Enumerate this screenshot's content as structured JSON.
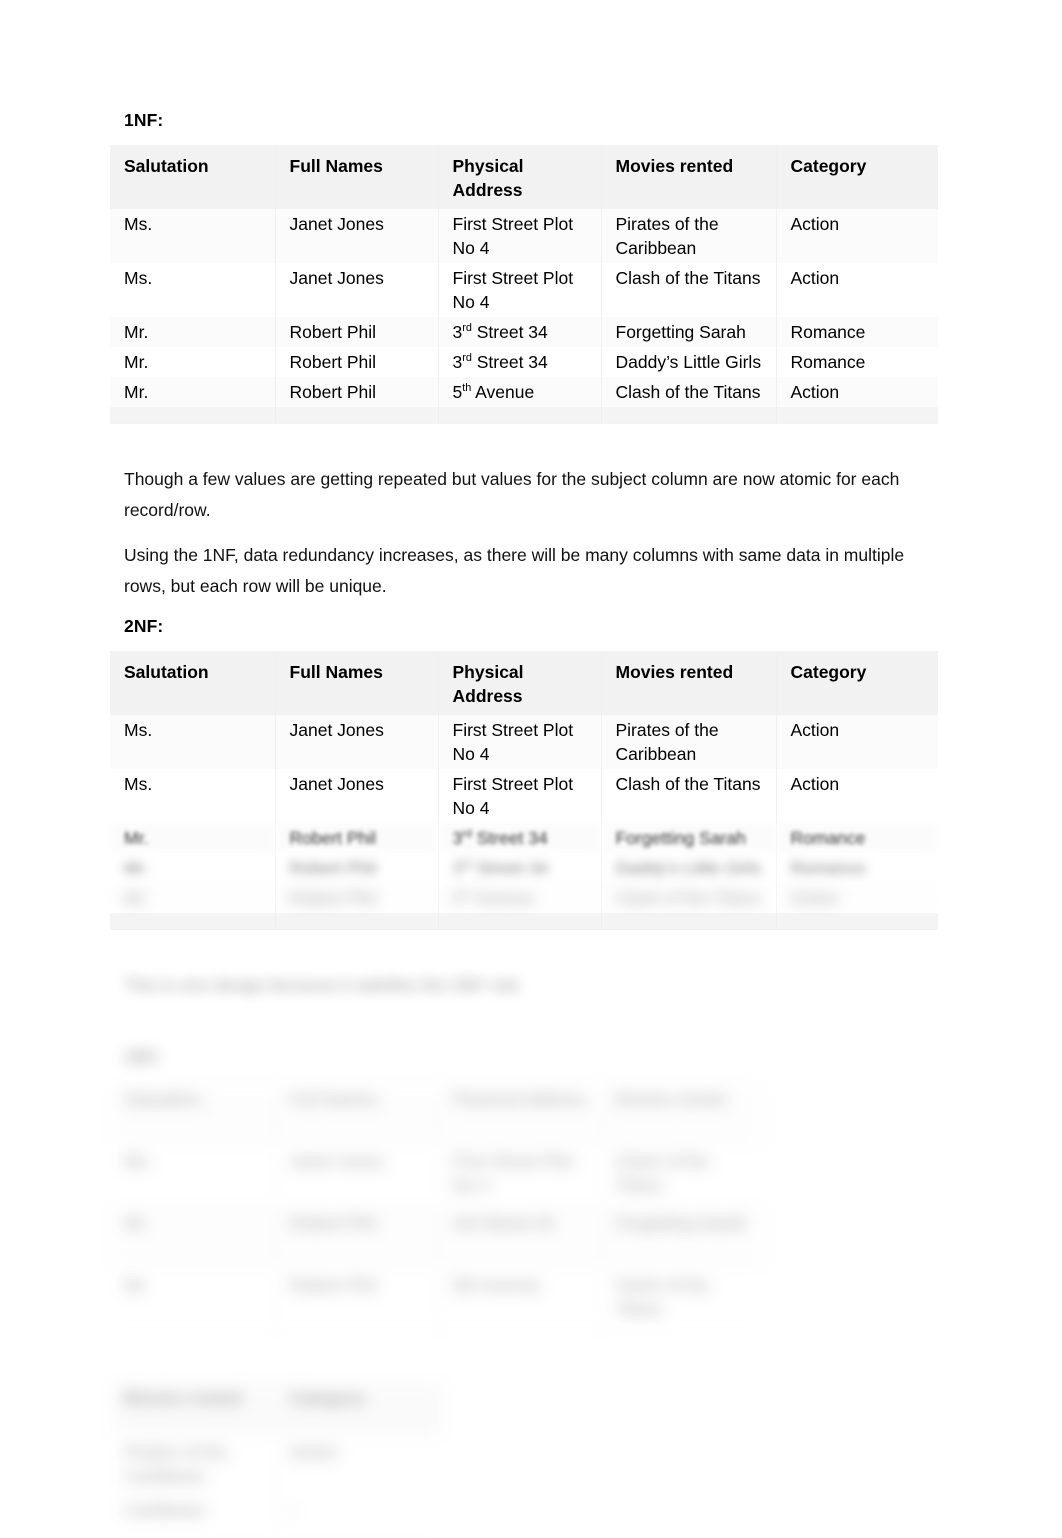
{
  "document": {
    "sections": {
      "onenf": {
        "heading": "1NF:",
        "table": {
          "columns": [
            "Salutation",
            "Full Names",
            "Physical Address",
            "Movies rented",
            "Category"
          ],
          "rows": [
            {
              "salutation": "Ms.",
              "full_names": "Janet Jones",
              "address_main": "First Street Plot",
              "address_sup": "",
              "address_rest": "No 4",
              "movie": "Pirates of the",
              "movie_line2": "Caribbean",
              "category": "Action"
            },
            {
              "salutation": "Ms.",
              "full_names": "Janet Jones",
              "address_main": "First Street Plot",
              "address_sup": "",
              "address_rest": "No 4",
              "movie": "Clash of the Titans",
              "movie_line2": "",
              "category": "Action"
            },
            {
              "salutation": "Mr.",
              "full_names": "Robert Phil",
              "address_main": "3",
              "address_sup": "rd",
              "address_rest": " Street 34",
              "movie": "Forgetting Sarah",
              "movie_line2": "",
              "category": "Romance"
            },
            {
              "salutation": "Mr.",
              "full_names": "Robert Phil",
              "address_main": "3",
              "address_sup": "rd",
              "address_rest": " Street 34",
              "movie": "Daddy’s Little Girls",
              "movie_line2": "",
              "category": "Romance"
            },
            {
              "salutation": "Mr.",
              "full_names": "Robert Phil",
              "address_main": "5",
              "address_sup": "th",
              "address_rest": " Avenue",
              "movie": "Clash of the Titans",
              "movie_line2": "",
              "category": "Action"
            }
          ]
        }
      },
      "paragraphs": {
        "p1": "Though a few values are getting repeated but values for the subject column are now atomic for each record/row.",
        "p2": "Using the 1NF, data redundancy increases, as there will be many columns with same data in multiple rows, but each row will be unique."
      },
      "twonf": {
        "heading": "2NF:",
        "table": {
          "columns": [
            "Salutation",
            "Full Names",
            "Physical Address",
            "Movies rented",
            "Category"
          ],
          "rows": [
            {
              "salutation": "Ms.",
              "full_names": "Janet Jones",
              "address_main": "First Street Plot",
              "address_sup": "",
              "address_rest": "No 4",
              "movie": "Pirates of the",
              "movie_line2": "Caribbean",
              "category": "Action",
              "blur": "none"
            },
            {
              "salutation": "Ms.",
              "full_names": "Janet Jones",
              "address_main": "First Street Plot",
              "address_sup": "",
              "address_rest": "No 4",
              "movie": "Clash of the Titans",
              "movie_line2": "",
              "category": "Action",
              "blur": "none"
            },
            {
              "salutation": "Mr.",
              "full_names": "Robert Phil",
              "address_main": "3",
              "address_sup": "rd",
              "address_rest": " Street 34",
              "movie": "Forgetting Sarah",
              "movie_line2": "",
              "category": "Romance",
              "blur": "soft"
            },
            {
              "salutation": "Mr.",
              "full_names": "Robert Phil",
              "address_main": "3",
              "address_sup": "rd",
              "address_rest": " Street 34",
              "movie": "Daddy’s Little Girls",
              "movie_line2": "",
              "category": "Romance",
              "blur": "med"
            },
            {
              "salutation": "Mr.",
              "full_names": "Robert Phil",
              "address_main": "5",
              "address_sup": "th",
              "address_rest": " Avenue",
              "movie": "Clash of the Titans",
              "movie_line2": "",
              "category": "Action",
              "blur": "heavy"
            }
          ]
        }
      },
      "obscured": {
        "note_paragraph": "This is one design because it satisfies the 3NF rule.",
        "heading": "3NF:",
        "table3": {
          "columns": [
            "Salutation",
            "Full Names",
            "Physical Address",
            "Movies rented"
          ],
          "rows": [
            {
              "c1": "Salutation",
              "c2": "Full Names",
              "c3": "Physical Address",
              "c4": "Movies rented"
            },
            {
              "c1": "Ms.",
              "c2": "Janet Jones",
              "c3": "First Street Plot No 4",
              "c4": "Clash of the Titans"
            },
            {
              "c1": "Mr.",
              "c2": "Robert Phil",
              "c3": "3rd Street 34",
              "c4": "Forgetting Sarah"
            },
            {
              "c1": "Mr.",
              "c2": "Robert Phil",
              "c3": "5th Avenue",
              "c4": "Clash of the Titans"
            }
          ]
        },
        "table4": {
          "columns": [
            "Movies rented",
            "Category"
          ],
          "rows": [
            {
              "c1": "Pirates of the Caribbean",
              "c2": "Action"
            },
            {
              "c1": "Caribbean",
              "c2": "-"
            }
          ]
        }
      }
    }
  }
}
